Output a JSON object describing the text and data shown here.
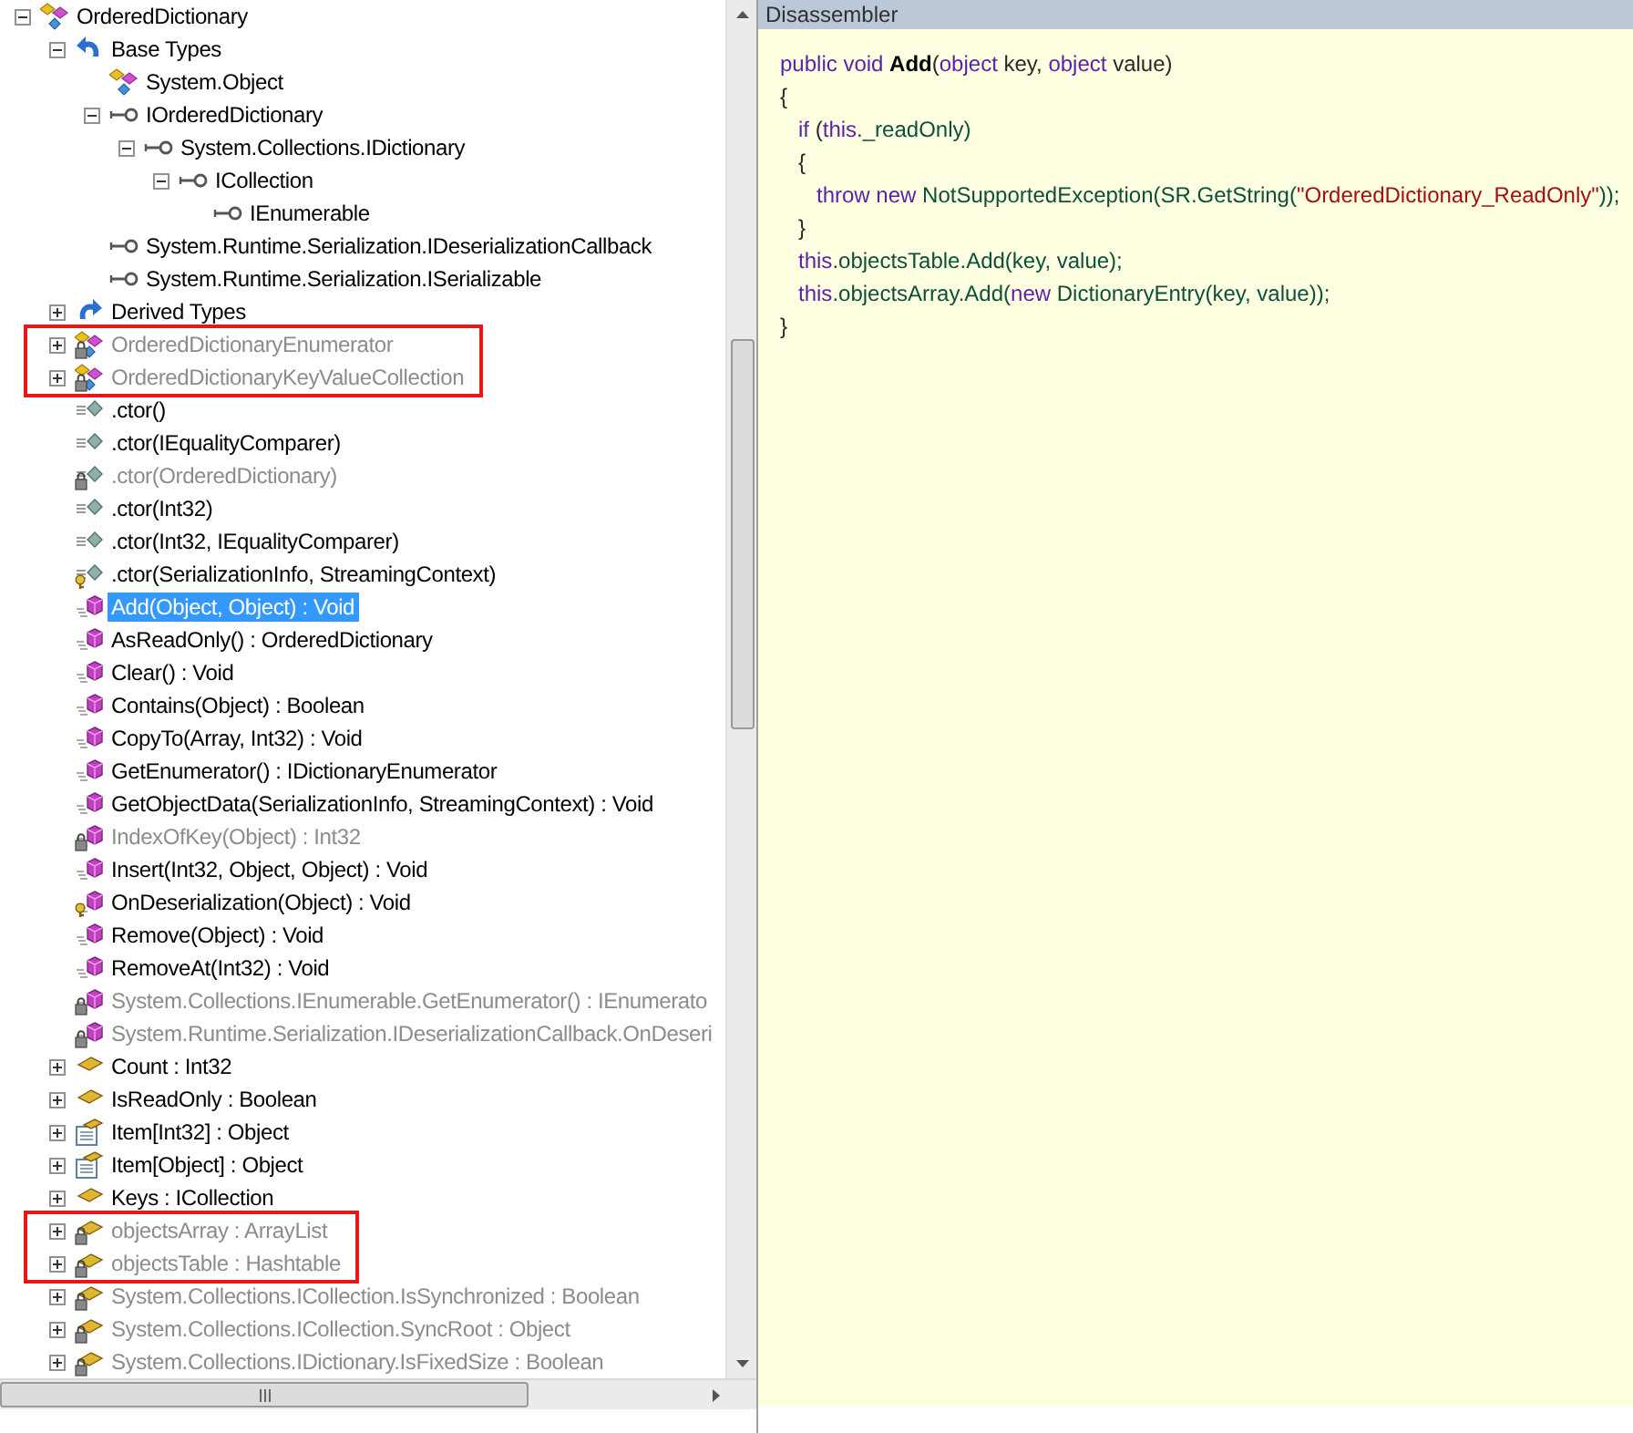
{
  "tree": {
    "text": "OrderedDictionary",
    "kind": "class",
    "private": false,
    "protected": false,
    "expanded": true,
    "selected": false,
    "highlighted": false,
    "children": [
      {
        "text": "Base Types",
        "kind": "base-types",
        "private": false,
        "protected": false,
        "expanded": true,
        "selected": false,
        "highlighted": false,
        "children": [
          {
            "text": "System.Object",
            "kind": "class",
            "private": false,
            "protected": false,
            "selected": false,
            "highlighted": false
          },
          {
            "text": "IOrderedDictionary",
            "kind": "interface",
            "private": false,
            "protected": false,
            "expanded": true,
            "selected": false,
            "highlighted": false,
            "children": [
              {
                "text": "System.Collections.IDictionary",
                "kind": "interface",
                "private": false,
                "protected": false,
                "expanded": true,
                "selected": false,
                "highlighted": false,
                "children": [
                  {
                    "text": "ICollection",
                    "kind": "interface",
                    "private": false,
                    "protected": false,
                    "expanded": true,
                    "selected": false,
                    "highlighted": false,
                    "children": [
                      {
                        "text": "IEnumerable",
                        "kind": "interface",
                        "private": false,
                        "protected": false,
                        "selected": false,
                        "highlighted": false
                      }
                    ]
                  }
                ]
              }
            ]
          },
          {
            "text": "System.Runtime.Serialization.IDeserializationCallback",
            "kind": "interface",
            "private": false,
            "protected": false,
            "selected": false,
            "highlighted": false
          },
          {
            "text": "System.Runtime.Serialization.ISerializable",
            "kind": "interface",
            "private": false,
            "protected": false,
            "selected": false,
            "highlighted": false
          }
        ]
      },
      {
        "text": "Derived Types",
        "kind": "derived-types",
        "private": false,
        "protected": false,
        "expanded": false,
        "selected": false,
        "highlighted": false
      },
      {
        "text": "OrderedDictionaryEnumerator",
        "kind": "class",
        "private": true,
        "protected": false,
        "expanded": false,
        "selected": false,
        "highlighted": true
      },
      {
        "text": "OrderedDictionaryKeyValueCollection",
        "kind": "class",
        "private": true,
        "protected": false,
        "expanded": false,
        "selected": false,
        "highlighted": true
      },
      {
        "text": ".ctor()",
        "kind": "constructor",
        "private": false,
        "protected": false,
        "selected": false,
        "highlighted": false
      },
      {
        "text": ".ctor(IEqualityComparer)",
        "kind": "constructor",
        "private": false,
        "protected": false,
        "selected": false,
        "highlighted": false
      },
      {
        "text": ".ctor(OrderedDictionary)",
        "kind": "constructor",
        "private": true,
        "protected": false,
        "selected": false,
        "highlighted": false
      },
      {
        "text": ".ctor(Int32)",
        "kind": "constructor",
        "private": false,
        "protected": false,
        "selected": false,
        "highlighted": false
      },
      {
        "text": ".ctor(Int32, IEqualityComparer)",
        "kind": "constructor",
        "private": false,
        "protected": false,
        "selected": false,
        "highlighted": false
      },
      {
        "text": ".ctor(SerializationInfo, StreamingContext)",
        "kind": "constructor",
        "private": false,
        "protected": true,
        "selected": false,
        "highlighted": false
      },
      {
        "text": "Add(Object, Object) : Void",
        "kind": "method",
        "private": false,
        "protected": false,
        "selected": true,
        "highlighted": false
      },
      {
        "text": "AsReadOnly() : OrderedDictionary",
        "kind": "method",
        "private": false,
        "protected": false,
        "selected": false,
        "highlighted": false
      },
      {
        "text": "Clear() : Void",
        "kind": "method",
        "private": false,
        "protected": false,
        "selected": false,
        "highlighted": false
      },
      {
        "text": "Contains(Object) : Boolean",
        "kind": "method",
        "private": false,
        "protected": false,
        "selected": false,
        "highlighted": false
      },
      {
        "text": "CopyTo(Array, Int32) : Void",
        "kind": "method",
        "private": false,
        "protected": false,
        "selected": false,
        "highlighted": false
      },
      {
        "text": "GetEnumerator() : IDictionaryEnumerator",
        "kind": "method",
        "private": false,
        "protected": false,
        "selected": false,
        "highlighted": false
      },
      {
        "text": "GetObjectData(SerializationInfo, StreamingContext) : Void",
        "kind": "method",
        "private": false,
        "protected": false,
        "selected": false,
        "highlighted": false
      },
      {
        "text": "IndexOfKey(Object) : Int32",
        "kind": "method",
        "private": true,
        "protected": false,
        "selected": false,
        "highlighted": false
      },
      {
        "text": "Insert(Int32, Object, Object) : Void",
        "kind": "method",
        "private": false,
        "protected": false,
        "selected": false,
        "highlighted": false
      },
      {
        "text": "OnDeserialization(Object) : Void",
        "kind": "method",
        "private": false,
        "protected": true,
        "selected": false,
        "highlighted": false
      },
      {
        "text": "Remove(Object) : Void",
        "kind": "method",
        "private": false,
        "protected": false,
        "selected": false,
        "highlighted": false
      },
      {
        "text": "RemoveAt(Int32) : Void",
        "kind": "method",
        "private": false,
        "protected": false,
        "selected": false,
        "highlighted": false
      },
      {
        "text": "System.Collections.IEnumerable.GetEnumerator() : IEnumerato",
        "kind": "method",
        "private": true,
        "protected": false,
        "selected": false,
        "highlighted": false
      },
      {
        "text": "System.Runtime.Serialization.IDeserializationCallback.OnDeseri",
        "kind": "method",
        "private": true,
        "protected": false,
        "selected": false,
        "highlighted": false
      },
      {
        "text": "Count : Int32",
        "kind": "property",
        "private": false,
        "protected": false,
        "expanded": false,
        "selected": false,
        "highlighted": false
      },
      {
        "text": "IsReadOnly : Boolean",
        "kind": "property",
        "private": false,
        "protected": false,
        "expanded": false,
        "selected": false,
        "highlighted": false
      },
      {
        "text": "Item[Int32] : Object",
        "kind": "indexer",
        "private": false,
        "protected": false,
        "expanded": false,
        "selected": false,
        "highlighted": false
      },
      {
        "text": "Item[Object] : Object",
        "kind": "indexer",
        "private": false,
        "protected": false,
        "expanded": false,
        "selected": false,
        "highlighted": false
      },
      {
        "text": "Keys : ICollection",
        "kind": "property",
        "private": false,
        "protected": false,
        "expanded": false,
        "selected": false,
        "highlighted": false
      },
      {
        "text": "objectsArray : ArrayList",
        "kind": "property",
        "private": true,
        "protected": false,
        "expanded": false,
        "selected": false,
        "highlighted": true
      },
      {
        "text": "objectsTable : Hashtable",
        "kind": "property",
        "private": true,
        "protected": false,
        "expanded": false,
        "selected": false,
        "highlighted": true
      },
      {
        "text": "System.Collections.ICollection.IsSynchronized : Boolean",
        "kind": "property",
        "private": true,
        "protected": false,
        "expanded": false,
        "selected": false,
        "highlighted": false
      },
      {
        "text": "System.Collections.ICollection.SyncRoot : Object",
        "kind": "property",
        "private": true,
        "protected": false,
        "expanded": false,
        "selected": false,
        "highlighted": false
      },
      {
        "text": "System.Collections.IDictionary.IsFixedSize : Boolean",
        "kind": "property",
        "private": true,
        "protected": false,
        "expanded": false,
        "selected": false,
        "highlighted": false
      }
    ]
  },
  "disassembler": {
    "title": "Disassembler",
    "lines": [
      [
        {
          "text": "public void ",
          "kind": "keyword"
        },
        {
          "text": "Add",
          "kind": "name"
        },
        {
          "text": "(",
          "kind": "plain"
        },
        {
          "text": "object",
          "kind": "keyword"
        },
        {
          "text": " key, ",
          "kind": "plain"
        },
        {
          "text": "object",
          "kind": "keyword"
        },
        {
          "text": " value)",
          "kind": "plain"
        }
      ],
      [
        {
          "text": "{",
          "kind": "plain"
        }
      ],
      [
        {
          "text": "   if",
          "kind": "keyword"
        },
        {
          "text": " (",
          "kind": "plain"
        },
        {
          "text": "this",
          "kind": "keyword"
        },
        {
          "text": "._readOnly)",
          "kind": "identifier"
        }
      ],
      [
        {
          "text": "   {",
          "kind": "plain"
        }
      ],
      [
        {
          "text": "      throw new ",
          "kind": "keyword"
        },
        {
          "text": "NotSupportedException(SR.GetString(",
          "kind": "identifier"
        },
        {
          "text": "\"OrderedDictionary_ReadOnly\"",
          "kind": "string"
        },
        {
          "text": "));",
          "kind": "identifier"
        }
      ],
      [
        {
          "text": "   }",
          "kind": "plain"
        }
      ],
      [
        {
          "text": "   this",
          "kind": "keyword"
        },
        {
          "text": ".objectsTable.Add(key, value);",
          "kind": "identifier"
        }
      ],
      [
        {
          "text": "   this",
          "kind": "keyword"
        },
        {
          "text": ".objectsArray.Add(",
          "kind": "identifier"
        },
        {
          "text": "new",
          "kind": "keyword"
        },
        {
          "text": " DictionaryEntry(key, value));",
          "kind": "identifier"
        }
      ],
      [
        {
          "text": "}",
          "kind": "plain"
        }
      ]
    ]
  }
}
